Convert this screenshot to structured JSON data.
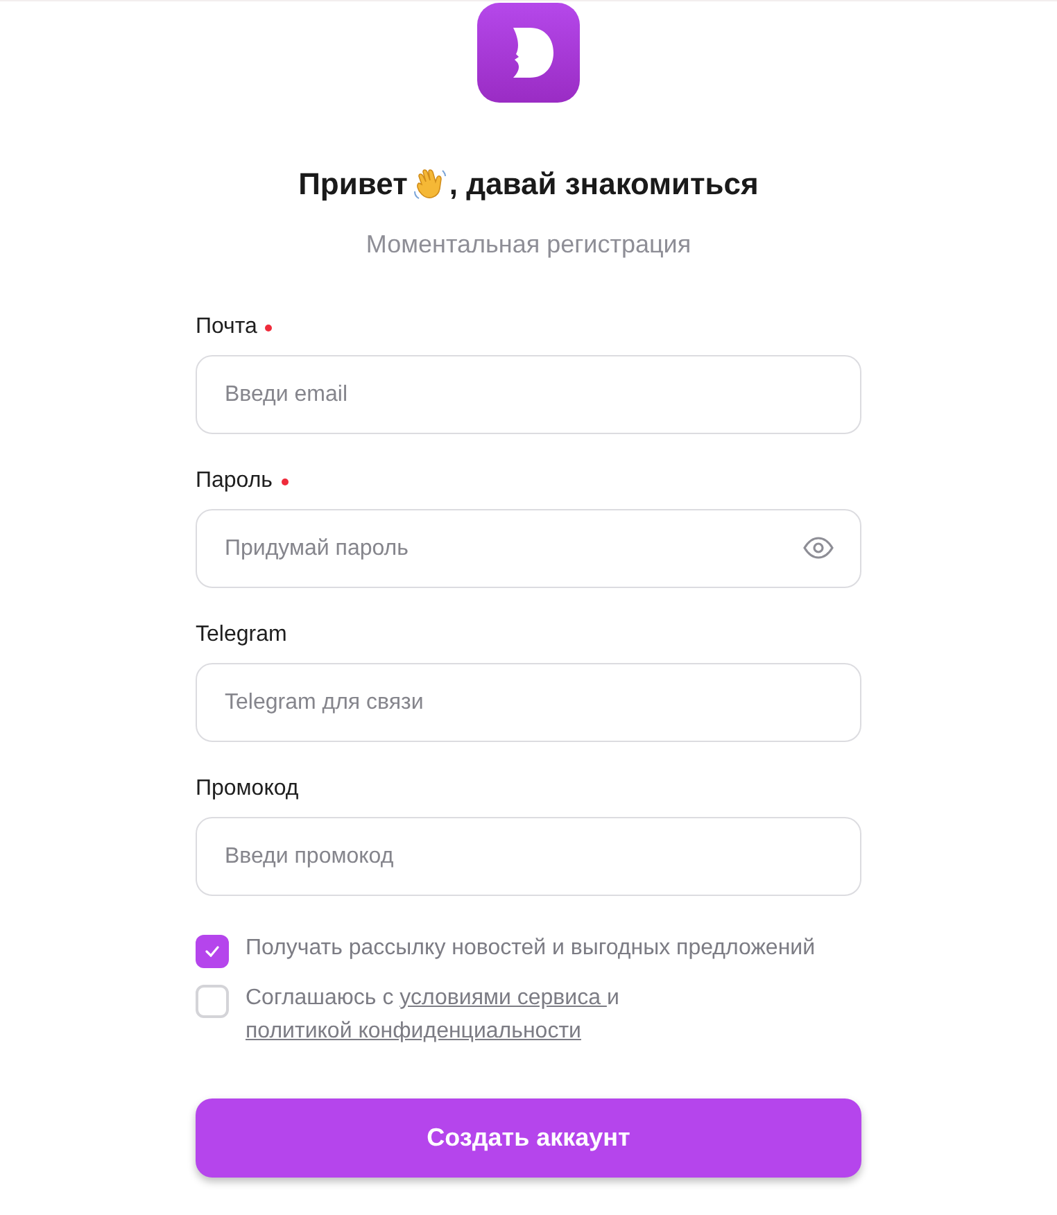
{
  "title_before": "Привет",
  "title_after": ", давай знакомиться",
  "subtitle": "Моментальная регистрация",
  "fields": [
    {
      "label": "Почта",
      "required": true,
      "placeholder": "Введи email",
      "kind": "text"
    },
    {
      "label": "Пароль",
      "required": true,
      "placeholder": "Придумай пароль",
      "kind": "password"
    },
    {
      "label": "Telegram",
      "required": false,
      "placeholder": "Telegram для связи",
      "kind": "text"
    },
    {
      "label": "Промокод",
      "required": false,
      "placeholder": "Введи промокод",
      "kind": "text"
    }
  ],
  "newsletter": {
    "checked": true,
    "text": "Получать рассылку новостей и выгодных предложений"
  },
  "consent": {
    "checked": false,
    "parts": [
      {
        "kind": "text",
        "text": "Соглашаюсь с "
      },
      {
        "kind": "link",
        "text": "условиями сервиса "
      },
      {
        "kind": "text",
        "text": "и "
      },
      {
        "kind": "link",
        "text": "политикой конфиденциальности"
      }
    ]
  },
  "submit": "Создать аккаунт"
}
